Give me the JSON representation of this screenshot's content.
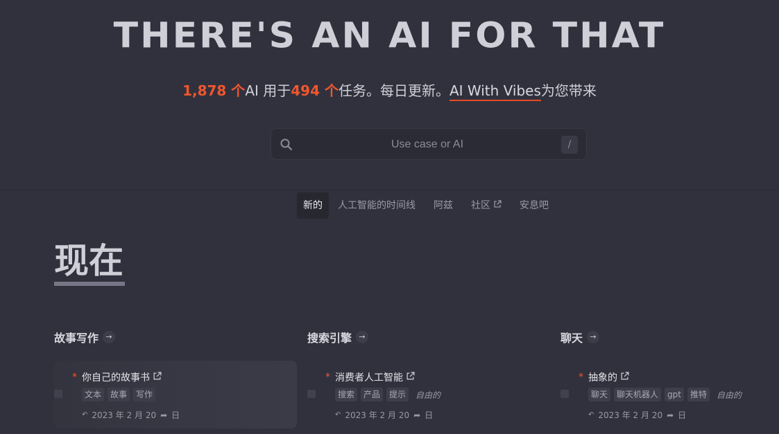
{
  "hero": {
    "title": "THERE'S AN AI FOR THAT"
  },
  "subtitle": {
    "ai_count": "1,878 个",
    "ai_label": "AI 用于",
    "task_count": "494 个",
    "task_label": "任务。每日更新。",
    "sponsor_link": "AI With Vibes",
    "sponsor_suffix": "为您带来"
  },
  "search": {
    "placeholder": "Use case or AI",
    "shortcut": "/"
  },
  "tabs": [
    {
      "label": "新的",
      "active": true
    },
    {
      "label": "人工智能的时间线"
    },
    {
      "label": "阿兹"
    },
    {
      "label": "社区",
      "external": true
    },
    {
      "label": "安息吧"
    }
  ],
  "section": {
    "title": "现在"
  },
  "columns": [
    {
      "category": "故事写作",
      "item": {
        "title": "你自己的故事书",
        "tags": [
          "文本",
          "故事",
          "写作"
        ],
        "pricing": "",
        "date": "2023 年 2 月 20",
        "period": "日"
      }
    },
    {
      "category": "搜索引擎",
      "item": {
        "title": "消费者人工智能",
        "tags": [
          "搜索",
          "产品",
          "提示"
        ],
        "pricing": "自由的",
        "date": "2023 年 2 月 20",
        "period": "日"
      }
    },
    {
      "category": "聊天",
      "item": {
        "title": "抽象的",
        "tags": [
          "聊天",
          "聊天机器人",
          "gpt",
          "推特"
        ],
        "pricing": "自由的",
        "date": "2023 年 2 月 20",
        "period": "日"
      }
    }
  ],
  "colors": {
    "accent": "#f0562e",
    "background": "#31313d"
  },
  "icons": {
    "search": "search-icon",
    "external": "external-link-icon",
    "arrow": "arrow-right-icon",
    "share": "share-icon",
    "history": "history-icon"
  }
}
